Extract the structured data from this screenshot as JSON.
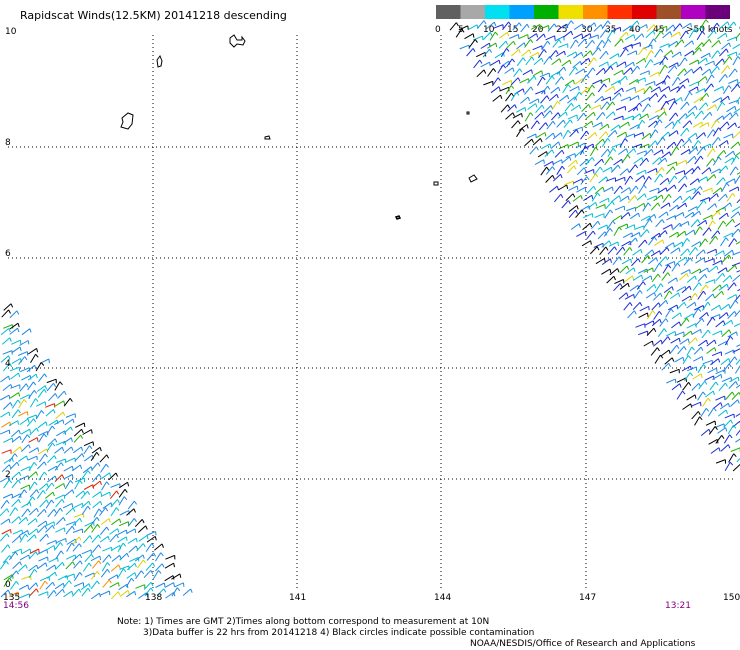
{
  "title": "Rapidscat Winds(12.5KM) 20141218 descending",
  "legend": {
    "labels": [
      "0",
      "5",
      "10",
      "15",
      "20",
      "25",
      "30",
      "35",
      "40",
      "45",
      ">50 knots"
    ],
    "colors": [
      "#606060",
      "#a8a8a8",
      "#00e0f0",
      "#00a0ff",
      "#00b000",
      "#f0e000",
      "#ff9000",
      "#ff3000",
      "#e00000",
      "#a05028",
      "#b000c0",
      "#6a007a"
    ]
  },
  "axes": {
    "y_labels": [
      "10",
      "8",
      "6",
      "4",
      "2",
      "0"
    ],
    "x_labels": [
      "135",
      "138",
      "141",
      "144",
      "147",
      "150"
    ]
  },
  "times": {
    "left": "14:56",
    "right": "13:21"
  },
  "notes": {
    "line1": "Note: 1) Times are GMT 2)Times along bottom correspond to measurement at 10N",
    "line2": "3)Data buffer is 22 hrs from 20141218 4) Black circles indicate possible contamination",
    "line3": "NOAA/NESDIS/Office of Research and Applications"
  },
  "wind_colors": {
    "low": "#00bcd4",
    "mid": "#1e88e5",
    "high": "#1a2bd8",
    "green": "#22b000",
    "yellow": "#e0d000",
    "orange": "#ff8c00",
    "red": "#e02000",
    "rain_flag": "#000000"
  }
}
